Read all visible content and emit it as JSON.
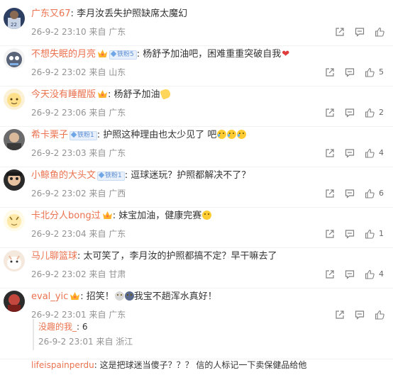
{
  "colors": {
    "username": "#eb7350",
    "meta": "#939393",
    "text": "#333333",
    "fan_badge": "#5c8ed4"
  },
  "comments": [
    {
      "user": "广东又67",
      "crown": false,
      "fan_badge": "",
      "text": "李月汝丢失护照缺席太魔幻",
      "time": "26-9-2 23:10",
      "location": "来自 广东",
      "likes": ""
    },
    {
      "user": "不想失眠的月亮",
      "crown": true,
      "fan_badge": "铁粉5",
      "text": "杨舒予加油吧，困难重重突破自我",
      "time": "26-9-2 23:02",
      "location": "来自 山东",
      "likes": "5"
    },
    {
      "user": "今天没有睡醒版",
      "crown": true,
      "fan_badge": "",
      "text": "杨舒予加油",
      "time": "26-9-2 23:06",
      "location": "来自 广东",
      "likes": "2"
    },
    {
      "user": "希卡栗子",
      "crown": false,
      "fan_badge": "铁粉1",
      "text": "护照这种理由也太少见了 吧",
      "time": "26-9-2 23:03",
      "location": "来自 广东",
      "likes": "4"
    },
    {
      "user": "小鲸鱼的大头文",
      "crown": false,
      "fan_badge": "铁粉1",
      "text": "逗球迷玩？护照都解决不了？",
      "time": "26-9-2 23:02",
      "location": "来自 广西",
      "likes": "6"
    },
    {
      "user": "卡北分人bong过",
      "crown": true,
      "fan_badge": "",
      "text": "妹宝加油，健康完赛",
      "time": "26-9-2 23:04",
      "location": "来自 广东",
      "likes": "1"
    },
    {
      "user": "马儿聊篮球",
      "crown": false,
      "fan_badge": "",
      "text": "太可笑了，李月汝的护照都搞不定？早干嘛去了",
      "time": "26-9-2 23:02",
      "location": "来自 甘肃",
      "likes": "4"
    },
    {
      "user": "eval_yic",
      "crown": true,
      "fan_badge": "",
      "text": "招笑！",
      "text2": "我宝不趟浑水真好！",
      "time": "26-9-2 23:01",
      "location": "来自 广东",
      "likes": ""
    }
  ],
  "reply": {
    "user": "没趣的我_",
    "text": "6",
    "time": "26-9-2 23:01",
    "location": "来自 浙江"
  },
  "last_comment": {
    "user": "lifeispainperdu",
    "text": "这是把球迷当傻子？？？ 信的人标记一下卖保健品给他"
  }
}
